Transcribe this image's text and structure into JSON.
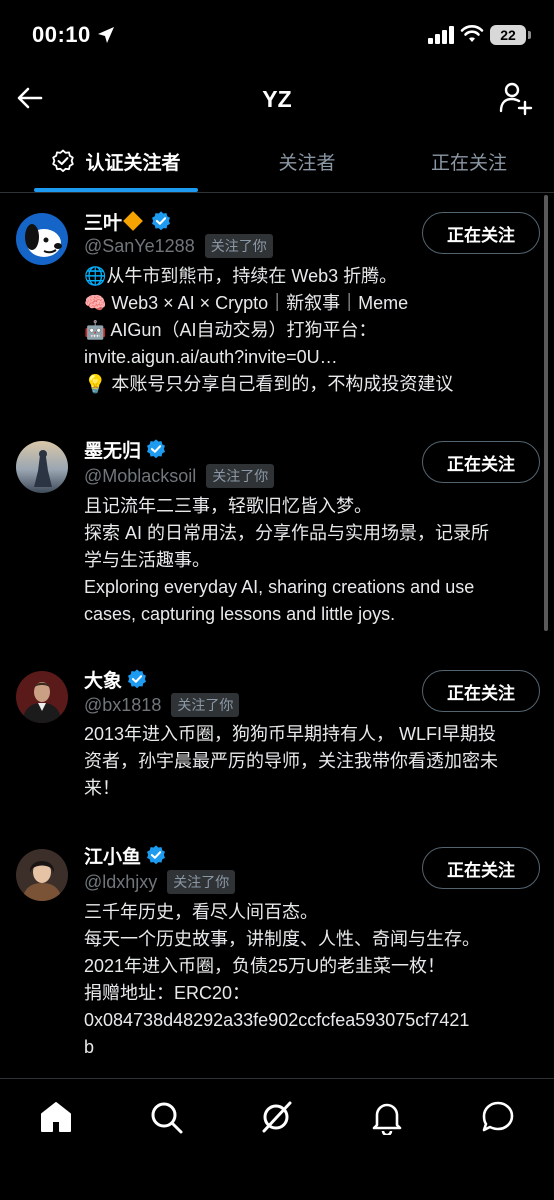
{
  "status_bar": {
    "time": "00:10",
    "battery": "22"
  },
  "header": {
    "title": "YZ"
  },
  "tabs": [
    {
      "label": "认证关注者"
    },
    {
      "label": "关注者"
    },
    {
      "label": "正在关注"
    }
  ],
  "users": [
    {
      "name": "三叶",
      "handle": "@SanYe1288",
      "follows_you": "关注了你",
      "button": "正在关注",
      "bio": [
        "🌐从牛市到熊市，持续在 Web3 折腾。",
        "🧠 Web3 × AI × Crypto｜新叙事｜Meme",
        "🤖 AIGun（AI自动交易）打狗平台：",
        "invite.aigun.ai/auth?invite=0U…",
        "💡 本账号只分享自己看到的，不构成投资建议"
      ]
    },
    {
      "name": "墨无归",
      "handle": "@Moblacksoil",
      "follows_you": "关注了你",
      "button": "正在关注",
      "bio": [
        "且记流年二三事，轻歌旧忆皆入梦。",
        "探索 AI 的日常用法，分享作品与实用场景，记录所",
        "学与生活趣事。",
        "Exploring everyday AI, sharing creations and use",
        "cases, capturing lessons and little joys."
      ]
    },
    {
      "name": "大象",
      "handle": "@bx1818",
      "follows_you": "关注了你",
      "button": "正在关注",
      "bio": [
        "2013年进入币圈，狗狗币早期持有人， WLFI早期投",
        "资者，孙宇晨最严厉的导师，关注我带你看透加密未",
        "来！"
      ]
    },
    {
      "name": "江小鱼",
      "handle": "@ldxhjxy",
      "follows_you": "关注了你",
      "button": "正在关注",
      "bio": [
        "三千年历史，看尽人间百态。",
        "每天一个历史故事，讲制度、人性、奇闻与生存。",
        "2021年进入币圈，负债25万U的老韭菜一枚！",
        "捐赠地址：ERC20：",
        "0x084738d48292a33fe902ccfcfea593075cf7421",
        "b"
      ]
    }
  ]
}
